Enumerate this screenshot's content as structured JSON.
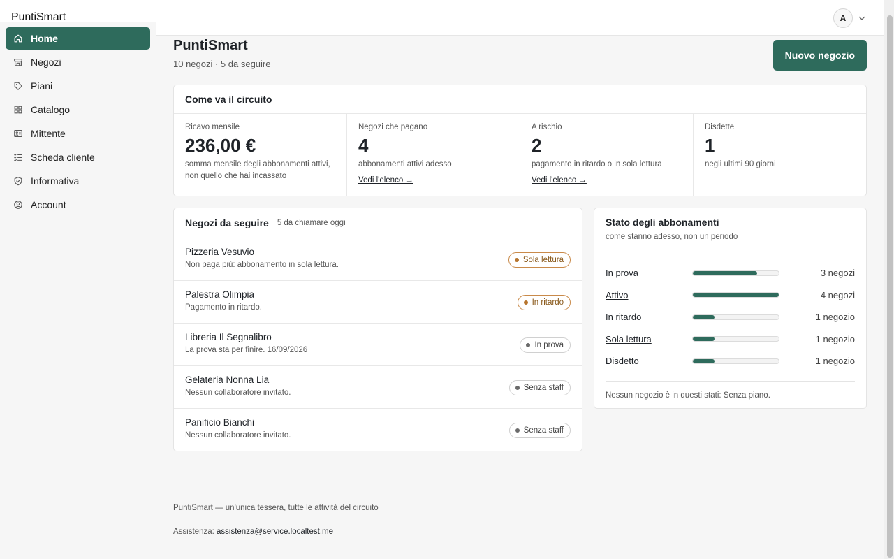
{
  "app": {
    "brand": "PuntiSmart"
  },
  "user": {
    "initial": "A"
  },
  "sidebar": {
    "items": [
      {
        "label": "Home",
        "icon": "home-icon",
        "active": true
      },
      {
        "label": "Negozi",
        "icon": "store-icon"
      },
      {
        "label": "Piani",
        "icon": "tag-icon"
      },
      {
        "label": "Catalogo",
        "icon": "grid-icon"
      },
      {
        "label": "Mittente",
        "icon": "id-card-icon"
      },
      {
        "label": "Scheda cliente",
        "icon": "checklist-icon"
      },
      {
        "label": "Informativa",
        "icon": "shield-check-icon"
      },
      {
        "label": "Account",
        "icon": "user-circle-icon"
      }
    ]
  },
  "header": {
    "title": "PuntiSmart",
    "subtitle": "10 negozi · 5 da seguire",
    "new_shop_label": "Nuovo negozio"
  },
  "kpi_card": {
    "title": "Come va il circuito",
    "kpis": [
      {
        "label": "Ricavo mensile",
        "value": "236,00 €",
        "desc": "somma mensile degli abbonamenti attivi, non quello che hai incassato",
        "link": ""
      },
      {
        "label": "Negozi che pagano",
        "value": "4",
        "desc": "abbonamenti attivi adesso",
        "link": "Vedi l'elenco →"
      },
      {
        "label": "A rischio",
        "value": "2",
        "desc": "pagamento in ritardo o in sola lettura",
        "link": "Vedi l'elenco →"
      },
      {
        "label": "Disdette",
        "value": "1",
        "desc": "negli ultimi 90 giorni",
        "link": ""
      }
    ]
  },
  "follow": {
    "title": "Negozi da seguire",
    "meta": "5 da chiamare oggi",
    "rows": [
      {
        "name": "Pizzeria Vesuvio",
        "note": "Non paga più: abbonamento in sola lettura.",
        "badge": "Sola lettura",
        "tone": "warn"
      },
      {
        "name": "Palestra Olimpia",
        "note": "Pagamento in ritardo.",
        "badge": "In ritardo",
        "tone": "warn"
      },
      {
        "name": "Libreria Il Segnalibro",
        "note": "La prova sta per finire. 16/09/2026",
        "badge": "In prova",
        "tone": "neutral"
      },
      {
        "name": "Gelateria Nonna Lia",
        "note": "Nessun collaboratore invitato.",
        "badge": "Senza staff",
        "tone": "neutral"
      },
      {
        "name": "Panificio Bianchi",
        "note": "Nessun collaboratore invitato.",
        "badge": "Senza staff",
        "tone": "neutral"
      }
    ]
  },
  "status": {
    "title": "Stato degli abbonamenti",
    "subtitle": "come stanno adesso, non un periodo",
    "rows": [
      {
        "name": "In prova",
        "count": "3 negozi",
        "fraction": 0.75
      },
      {
        "name": "Attivo",
        "count": "4 negozi",
        "fraction": 1.0
      },
      {
        "name": "In ritardo",
        "count": "1 negozio",
        "fraction": 0.25
      },
      {
        "name": "Sola lettura",
        "count": "1 negozio",
        "fraction": 0.25
      },
      {
        "name": "Disdetto",
        "count": "1 negozio",
        "fraction": 0.25
      }
    ],
    "footnote": "Nessun negozio è in questi stati: Senza piano."
  },
  "footer": {
    "tagline": "PuntiSmart — un'unica tessera, tutte le attività del circuito",
    "support_label": "Assistenza:",
    "support_email": "assistenza@service.localtest.me"
  },
  "colors": {
    "accent": "#2e6b5c",
    "warn": "#b7752e"
  }
}
